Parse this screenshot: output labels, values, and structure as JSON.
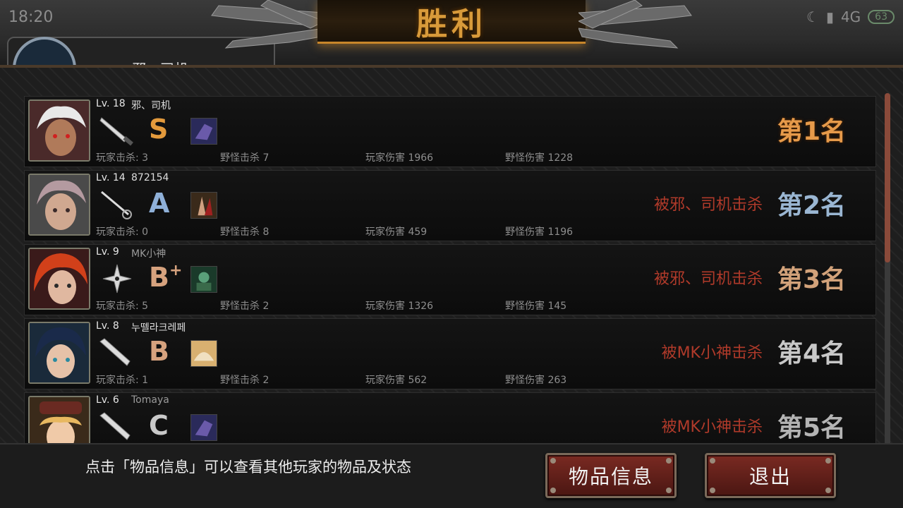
{
  "status_bar": {
    "time": "18:20",
    "network": "4G",
    "battery": "63"
  },
  "background_player": {
    "name": "邪、司机"
  },
  "title": "胜利",
  "players": [
    {
      "level": "Lv. 18",
      "name": "邪、司机",
      "weapon": "knife-icon",
      "grade": "S",
      "grade_plus": "",
      "grade_color": "#e39a3c",
      "stats": {
        "player_kills": "玩家击杀: 3",
        "monster_kills": "野怪击杀 7",
        "player_damage": "玩家伤害 1966",
        "monster_damage": "野怪伤害 1228"
      },
      "killed_by": "",
      "rank": "第1名"
    },
    {
      "level": "Lv. 14",
      "name": "872154",
      "weapon": "rapier-icon",
      "grade": "A",
      "grade_plus": "",
      "grade_color": "#8fb0d8",
      "stats": {
        "player_kills": "玩家击杀: 0",
        "monster_kills": "野怪击杀 8",
        "player_damage": "玩家伤害 459",
        "monster_damage": "野怪伤害 1196"
      },
      "killed_by": "被邪、司机击杀",
      "rank": "第2名"
    },
    {
      "level": "Lv. 9",
      "name": "MK小神",
      "weapon": "shuriken-icon",
      "grade": "B",
      "grade_plus": "+",
      "grade_color": "#d6a27e",
      "stats": {
        "player_kills": "玩家击杀: 5",
        "monster_kills": "野怪击杀 2",
        "player_damage": "玩家伤害 1326",
        "monster_damage": "野怪伤害 145"
      },
      "killed_by": "被邪、司机击杀",
      "rank": "第3名"
    },
    {
      "level": "Lv. 8",
      "name": "누뗄라크레페",
      "weapon": "bat-icon",
      "grade": "B",
      "grade_plus": "",
      "grade_color": "#d6a27e",
      "stats": {
        "player_kills": "玩家击杀: 1",
        "monster_kills": "野怪击杀 2",
        "player_damage": "玩家伤害 562",
        "monster_damage": "野怪伤害 263"
      },
      "killed_by": "被MK小神击杀",
      "rank": "第4名"
    },
    {
      "level": "Lv. 6",
      "name": "Tomaya",
      "weapon": "bat-icon",
      "grade": "C",
      "grade_plus": "",
      "grade_color": "#c9c9c9",
      "stats": {
        "player_kills": "",
        "monster_kills": "",
        "player_damage": "",
        "monster_damage": ""
      },
      "killed_by": "被MK小神击杀",
      "rank": "第5名"
    }
  ],
  "footer": {
    "hint": "点击「物品信息」可以查看其他玩家的物品及状态",
    "items_button": "物品信息",
    "exit_button": "退出"
  }
}
